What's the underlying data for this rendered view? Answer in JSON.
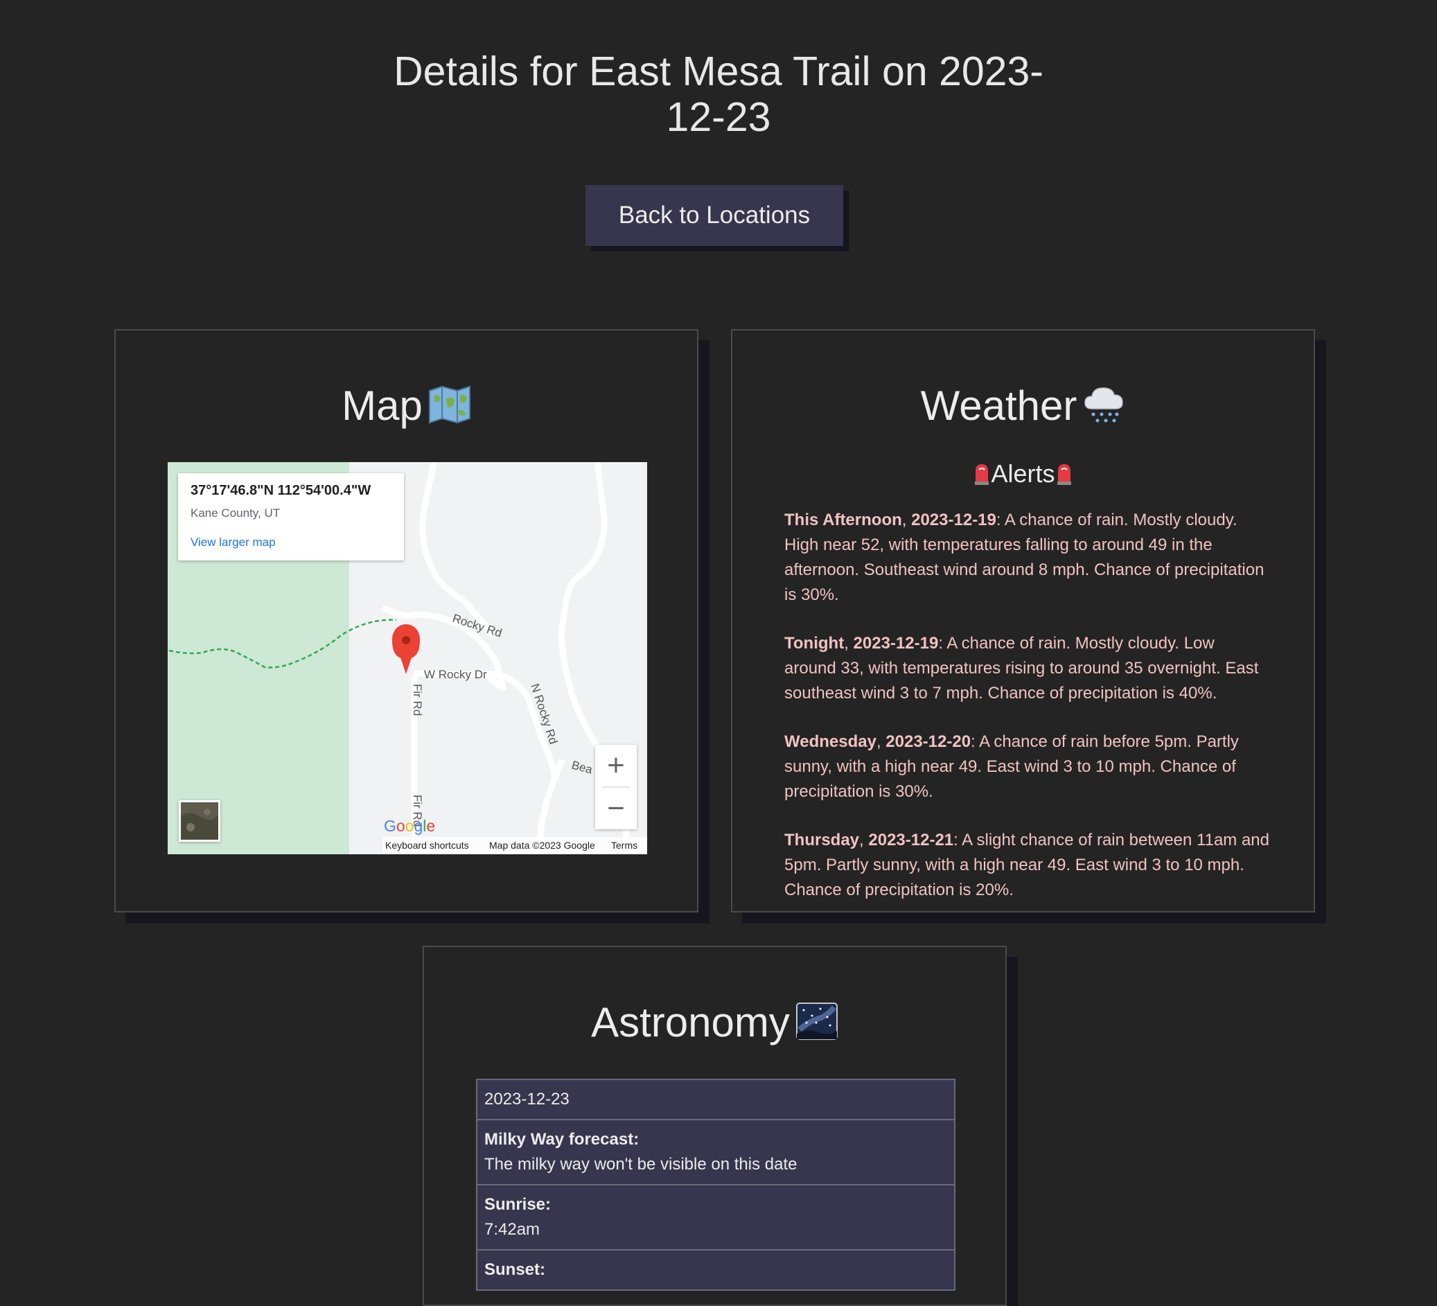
{
  "page": {
    "title": "Details for East Mesa Trail on 2023-12-23",
    "back_button": "Back to Locations"
  },
  "map_card": {
    "heading": "Map",
    "heading_icon": "world-map-icon",
    "info": {
      "coords": "37°17'46.8\"N 112°54'00.4\"W",
      "region": "Kane County, UT",
      "link": "View larger map"
    },
    "roads": {
      "rocky_rd": "Rocky Rd",
      "w_rocky_dr": "W Rocky Dr",
      "fir_rd_1": "Fir Rd",
      "fir_rd_2": "Fir Rd",
      "n_rocky_rd": "N Rocky Rd",
      "bea": "Bea"
    },
    "zoom_in": "+",
    "zoom_out": "−",
    "google_logo": "Google",
    "footer": {
      "shortcuts": "Keyboard shortcuts",
      "data": "Map data ©2023 Google",
      "terms": "Terms"
    },
    "colors": {
      "park": "#cde8d4",
      "pin": "#ea4335",
      "trail": "#34a853"
    }
  },
  "weather_card": {
    "heading": "Weather",
    "heading_icon": "cloud-snow-icon",
    "alerts_heading": "Alerts",
    "alerts_icon": "siren-icon",
    "alerts": [
      {
        "period": "This Afternoon",
        "date": "2023-12-19",
        "text": "A chance of rain. Mostly cloudy. High near 52, with temperatures falling to around 49 in the afternoon. Southeast wind around 8 mph. Chance of precipitation is 30%."
      },
      {
        "period": "Tonight",
        "date": "2023-12-19",
        "text": "A chance of rain. Mostly cloudy. Low around 33, with temperatures rising to around 35 overnight. East southeast wind 3 to 7 mph. Chance of precipitation is 40%."
      },
      {
        "period": "Wednesday",
        "date": "2023-12-20",
        "text": "A chance of rain before 5pm. Partly sunny, with a high near 49. East wind 3 to 10 mph. Chance of precipitation is 30%."
      },
      {
        "period": "Thursday",
        "date": "2023-12-21",
        "text": "A slight chance of rain between 11am and 5pm. Partly sunny, with a high near 49. East wind 3 to 10 mph. Chance of precipitation is 20%."
      }
    ],
    "alert_color": "#f2c2c2"
  },
  "astronomy_card": {
    "heading": "Astronomy",
    "heading_icon": "milky-way-icon",
    "date": "2023-12-23",
    "milky_way_label": "Milky Way forecast:",
    "milky_way_value": "The milky way won't be visible on this date",
    "sunrise_label": "Sunrise:",
    "sunrise_value": "7:42am",
    "sunset_label": "Sunset:"
  },
  "colors": {
    "background": "#242424",
    "accent": "#37364e",
    "shadow": "#17161f"
  }
}
